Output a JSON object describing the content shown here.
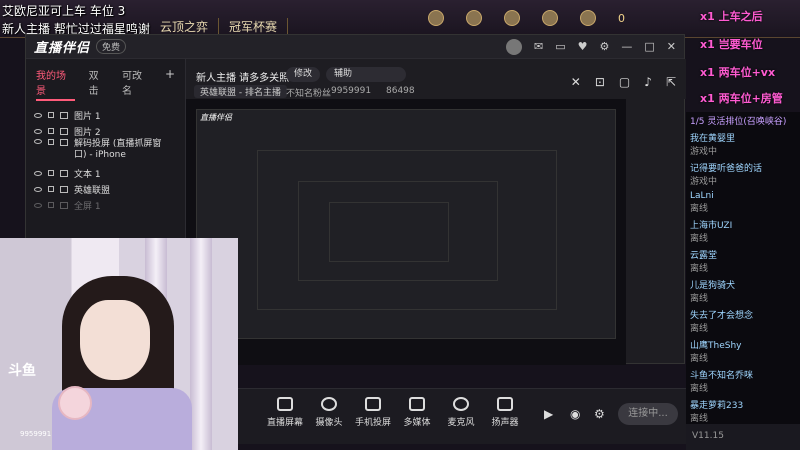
{
  "game_overlay": {
    "line1": "艾欧尼亚可上车 车位 3",
    "line2": "新人主播 帮忙过过福星鸣谢",
    "tabs": [
      "云顶之弈",
      "冠军杯赛"
    ],
    "gold": "0"
  },
  "app": {
    "logo": "直播伴侣",
    "badge": "免费",
    "scene_tabs": [
      "我的场景",
      "双击",
      "可改名"
    ],
    "sources": [
      "图片 1",
      "图片 2",
      "解码投屏 (直播抓屏窗口) - iPhone",
      "文本 1",
      "英雄联盟",
      "全屏 1"
    ],
    "streamer_title": "新人主播 请多多关照 ~",
    "edit_btn": "修改",
    "assist_btn": "辅助",
    "category": "英雄联盟 - 排名主播",
    "fans_label": "不知名粉丝",
    "fans_count": "9959991",
    "heat": "86498"
  },
  "danmu": [
    "x1 上车之后",
    "x1 岂要车位",
    "x1 两车位+vx",
    "x1 两车位+房管"
  ],
  "chat": {
    "header": "1/5 灵活排位(召唤峡谷)",
    "messages": [
      {
        "user": "我在黄婴里",
        "text": "游戏中"
      },
      {
        "user": "记得要听爸爸的话",
        "text": "游戏中"
      },
      {
        "user": "LaLni",
        "text": "离线"
      },
      {
        "user": "上海市UZI",
        "text": "离线"
      },
      {
        "user": "云露堂",
        "text": "离线"
      },
      {
        "user": "儿是狗骑犬",
        "text": "离线"
      },
      {
        "user": "失去了才会想念",
        "text": "离线"
      },
      {
        "user": "山鹰TheShy",
        "text": "离线"
      },
      {
        "user": "斗鱼不知名乔咪",
        "text": "离线"
      },
      {
        "user": "暴走萝莉233",
        "text": "离线"
      }
    ],
    "status_time": "V11.15"
  },
  "controls": [
    {
      "label": "直播屏幕"
    },
    {
      "label": "摄像头"
    },
    {
      "label": "手机投屏"
    },
    {
      "label": "多媒体"
    },
    {
      "label": "麦克风"
    },
    {
      "label": "扬声器"
    }
  ],
  "live_button": "连接中...",
  "cam": {
    "logo": "斗鱼",
    "room_id": "9959991"
  }
}
